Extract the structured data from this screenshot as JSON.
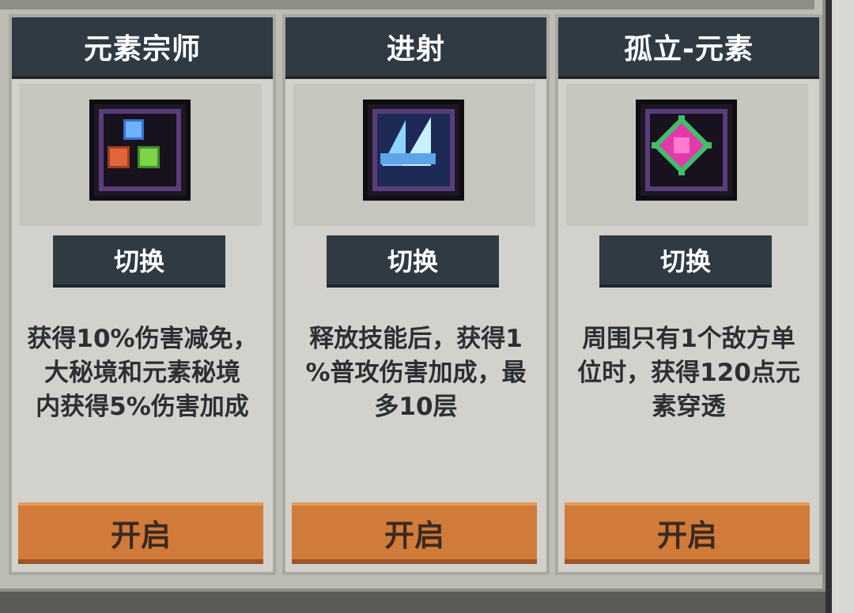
{
  "header": {
    "partial_title": ""
  },
  "cards": [
    {
      "title": "元素宗师",
      "icon": "elemental-orbs-icon",
      "switch_label": "切换",
      "description": [
        "获得10%伤害减免，",
        "大秘境和元素秘境",
        "内获得5%伤害加成"
      ],
      "enable_label": "开启"
    },
    {
      "title": "进射",
      "icon": "ice-shards-icon",
      "switch_label": "切换",
      "description": [
        "释放技能后，获得1",
        "%普攻伤害加成，最",
        "多10层"
      ],
      "enable_label": "开启"
    },
    {
      "title": "孤立-元素",
      "icon": "magenta-star-icon",
      "switch_label": "切换",
      "description": [
        "周围只有1个敌方单",
        "位时，获得120点元",
        "素穿透"
      ],
      "enable_label": "开启"
    }
  ],
  "colors": {
    "header_bg": "#2f3a43",
    "enable_button": "#d17b3a",
    "card_bg": "#d2d1cb"
  }
}
